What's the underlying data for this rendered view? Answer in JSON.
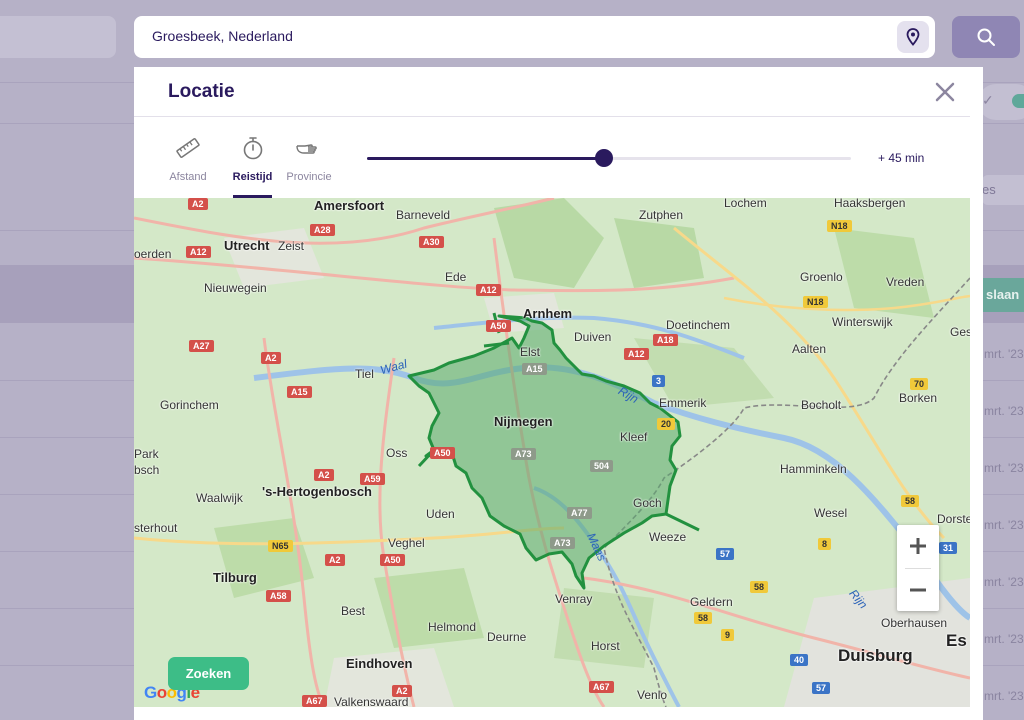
{
  "search": {
    "value": "Groesbeek, Nederland"
  },
  "modal": {
    "title": "Locatie",
    "tabs": [
      {
        "label": "Afstand",
        "icon": "ruler-icon",
        "active": false
      },
      {
        "label": "Reistijd",
        "icon": "stopwatch-icon",
        "active": true
      },
      {
        "label": "Provincie",
        "icon": "pointing-hand-icon",
        "active": false
      }
    ],
    "slider": {
      "value_label": "+ 45 min",
      "fraction": 0.49
    }
  },
  "map": {
    "cities": [
      {
        "name": "Amersfoort",
        "cls": "big"
      },
      {
        "name": "Barneveld",
        "cls": ""
      },
      {
        "name": "Zutphen",
        "cls": ""
      },
      {
        "name": "Lochem",
        "cls": ""
      },
      {
        "name": "Haaksbergen",
        "cls": ""
      },
      {
        "name": "Utrecht",
        "cls": "big"
      },
      {
        "name": "Zeist",
        "cls": ""
      },
      {
        "name": "oerden",
        "cls": ""
      },
      {
        "name": "Ede",
        "cls": ""
      },
      {
        "name": "Groenlo",
        "cls": ""
      },
      {
        "name": "Vreden",
        "cls": ""
      },
      {
        "name": "Nieuwegein",
        "cls": ""
      },
      {
        "name": "Arnhem",
        "cls": "big"
      },
      {
        "name": "Duiven",
        "cls": ""
      },
      {
        "name": "Doetinchem",
        "cls": ""
      },
      {
        "name": "Winterswijk",
        "cls": ""
      },
      {
        "name": "Elst",
        "cls": ""
      },
      {
        "name": "Aalten",
        "cls": ""
      },
      {
        "name": "Ges",
        "cls": ""
      },
      {
        "name": "Tiel",
        "cls": ""
      },
      {
        "name": "Emmerik",
        "cls": ""
      },
      {
        "name": "Bocholt",
        "cls": ""
      },
      {
        "name": "Borken",
        "cls": ""
      },
      {
        "name": "Gorinchem",
        "cls": ""
      },
      {
        "name": "Nijmegen",
        "cls": "big"
      },
      {
        "name": "Kleef",
        "cls": ""
      },
      {
        "name": "Park",
        "cls": ""
      },
      {
        "name": "bsch",
        "cls": ""
      },
      {
        "name": "Oss",
        "cls": ""
      },
      {
        "name": "Hamminkeln",
        "cls": ""
      },
      {
        "name": "Waalwijk",
        "cls": ""
      },
      {
        "name": "'s-Hertogenbosch",
        "cls": "big"
      },
      {
        "name": "Goch",
        "cls": ""
      },
      {
        "name": "sterhout",
        "cls": ""
      },
      {
        "name": "Uden",
        "cls": ""
      },
      {
        "name": "Wesel",
        "cls": ""
      },
      {
        "name": "Dorste",
        "cls": ""
      },
      {
        "name": "Weeze",
        "cls": ""
      },
      {
        "name": "Veghel",
        "cls": ""
      },
      {
        "name": "Tilburg",
        "cls": "big"
      },
      {
        "name": "Venray",
        "cls": ""
      },
      {
        "name": "Geldern",
        "cls": ""
      },
      {
        "name": "Best",
        "cls": ""
      },
      {
        "name": "Helmond",
        "cls": ""
      },
      {
        "name": "Deurne",
        "cls": ""
      },
      {
        "name": "Oberhausen",
        "cls": ""
      },
      {
        "name": "Es",
        "cls": "huge"
      },
      {
        "name": "Horst",
        "cls": ""
      },
      {
        "name": "Eindhoven",
        "cls": "big"
      },
      {
        "name": "Duisburg",
        "cls": "huge"
      },
      {
        "name": "Venlo",
        "cls": ""
      },
      {
        "name": "Valkenswaard",
        "cls": ""
      }
    ],
    "water": [
      {
        "name": "Waal"
      },
      {
        "name": "Rijn"
      },
      {
        "name": "Maas"
      },
      {
        "name": "Rijn"
      }
    ],
    "roads": [
      {
        "label": "A2",
        "type": "red"
      },
      {
        "label": "A28",
        "type": "red"
      },
      {
        "label": "A30",
        "type": "red"
      },
      {
        "label": "N18",
        "type": "yellow"
      },
      {
        "label": "A12",
        "type": "red"
      },
      {
        "label": "A12",
        "type": "red"
      },
      {
        "label": "N18",
        "type": "yellow"
      },
      {
        "label": "A27",
        "type": "red"
      },
      {
        "label": "A2",
        "type": "red"
      },
      {
        "label": "A50",
        "type": "red"
      },
      {
        "label": "A15",
        "type": "grey"
      },
      {
        "label": "A12",
        "type": "red"
      },
      {
        "label": "A18",
        "type": "red"
      },
      {
        "label": "3",
        "type": "blue"
      },
      {
        "label": "70",
        "type": "yellow"
      },
      {
        "label": "A15",
        "type": "red"
      },
      {
        "label": "A2",
        "type": "red"
      },
      {
        "label": "A59",
        "type": "red"
      },
      {
        "label": "A73",
        "type": "grey"
      },
      {
        "label": "504",
        "type": "grey"
      },
      {
        "label": "A50",
        "type": "red"
      },
      {
        "label": "20",
        "type": "yellow"
      },
      {
        "label": "58",
        "type": "yellow"
      },
      {
        "label": "A77",
        "type": "grey"
      },
      {
        "label": "A73",
        "type": "grey"
      },
      {
        "label": "N65",
        "type": "yellow"
      },
      {
        "label": "A2",
        "type": "red"
      },
      {
        "label": "A50",
        "type": "red"
      },
      {
        "label": "57",
        "type": "blue"
      },
      {
        "label": "8",
        "type": "yellow"
      },
      {
        "label": "31",
        "type": "blue"
      },
      {
        "label": "A58",
        "type": "red"
      },
      {
        "label": "58",
        "type": "yellow"
      },
      {
        "label": "58",
        "type": "yellow"
      },
      {
        "label": "9",
        "type": "yellow"
      },
      {
        "label": "40",
        "type": "blue"
      },
      {
        "label": "A2",
        "type": "red"
      },
      {
        "label": "A67",
        "type": "red"
      },
      {
        "label": "A67",
        "type": "red"
      },
      {
        "label": "57",
        "type": "blue"
      }
    ],
    "attribution": "Google"
  },
  "actions": {
    "search_label": "Zoeken"
  },
  "background": {
    "save_label": "slaan",
    "tag_label": "es",
    "dates": [
      "mrt. '23",
      "mrt. '23",
      "mrt. '23",
      "mrt. '23",
      "mrt. '23",
      "mrt. '23",
      "mrt. '23"
    ]
  }
}
